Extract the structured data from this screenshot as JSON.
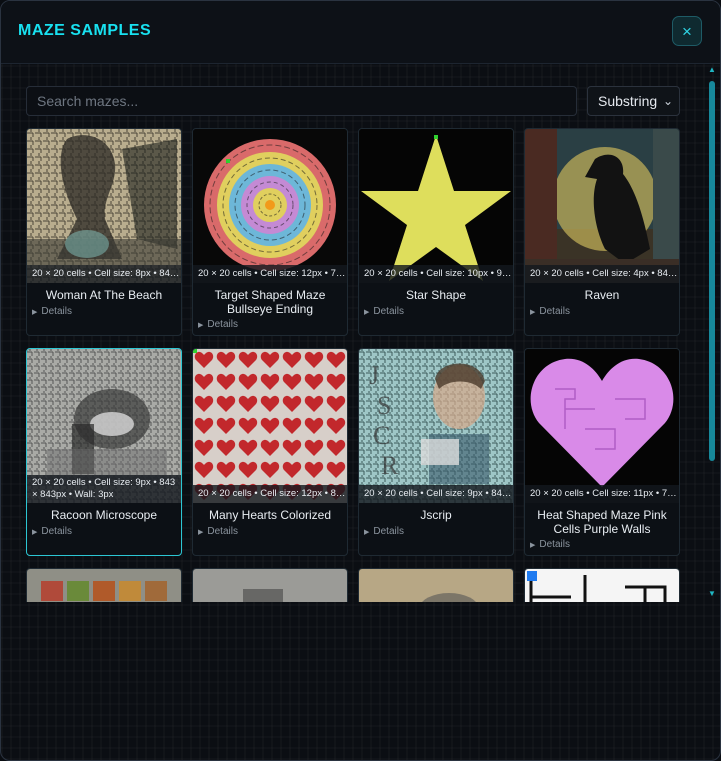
{
  "modal": {
    "title": "MAZE SAMPLES",
    "close_icon": "×"
  },
  "search": {
    "placeholder": "Search mazes...",
    "value": ""
  },
  "filter": {
    "selected": "Substring"
  },
  "cards": [
    {
      "name": "Woman At The Beach",
      "meta": "20 × 20 cells • Cell size: 8px • 84…",
      "details": "Details"
    },
    {
      "name": "Target Shaped Maze Bullseye Ending",
      "meta": "20 × 20 cells • Cell size: 12px • 7…",
      "details": "Details"
    },
    {
      "name": "Star Shape",
      "meta": "20 × 20 cells • Cell size: 10px • 9…",
      "details": "Details"
    },
    {
      "name": "Raven",
      "meta": "20 × 20 cells • Cell size: 4px • 84…",
      "details": "Details"
    },
    {
      "name": "Racoon Microscope",
      "meta": "20 × 20 cells • Cell size: 9px • 843 × 843px • Wall: 3px",
      "details": "Details"
    },
    {
      "name": "Many Hearts Colorized",
      "meta": "20 × 20 cells • Cell size: 12px • 8…",
      "details": "Details"
    },
    {
      "name": "Jscrip",
      "meta": "20 × 20 cells • Cell size: 9px • 84…",
      "details": "Details"
    },
    {
      "name": "Heat Shaped Maze Pink Cells Purple Walls",
      "meta": "20 × 20 cells • Cell size: 11px • 7…",
      "details": "Details"
    }
  ],
  "colors": {
    "accent": "#18e1f0",
    "selected_border": "#2cc6d3"
  }
}
